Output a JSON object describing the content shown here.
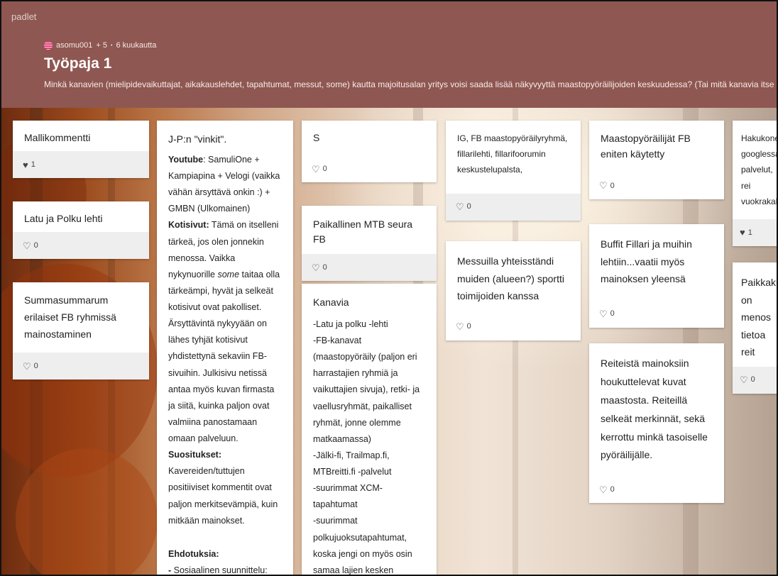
{
  "app": {
    "brand": "padlet"
  },
  "header": {
    "author": "asomu001",
    "extra": "+ 5",
    "sep": "•",
    "time": "6 kuukautta",
    "title": "Työpaja 1",
    "description": "Minkä kanavien (mielipidevaikuttajat, aikakauslehdet, tapahtumat, messut, some) kautta majoitusalan yritys voisi saada lisää näkyvyyttä maastopyöräilijoiden keskuudessa? (Tai mitä kanavia itse käytät tiedonhakemisessa)"
  },
  "cards": {
    "c1": {
      "title": "Mallikommentti",
      "likes": "1"
    },
    "c2": {
      "title": "Latu ja Polku lehti",
      "likes": "0"
    },
    "c3": {
      "title": "Summasummarum erilaiset FB ryhmissä mainostaminen",
      "likes": "0"
    },
    "c4": {
      "title": "J-P:n \"vinkit\".",
      "p1_bold": "Youtube",
      "p1_text": ": SamuliOne + Kampiapina + Velogi (vaikka vähän ärsyttävä onkin :) + GMBN (Ulkomainen)",
      "p2_bold": "Kotisivut:",
      "p2_text_a": " Tämä on itselleni tärkeä, jos olen jonnekin menossa. Vaikka nykynuorille ",
      "p2_em": "some",
      "p2_text_b": " taitaa olla tärkeämpi, hyvät ja selkeät kotisivut ovat pakolliset. Ärsyttävintä nykyyään on lähes tyhjät kotisivut yhdistettynä sekaviin FB-sivuihin. Julkisivu  netissä antaa myös kuvan firmasta ja siitä, kuinka paljon ovat valmiina panostamaan omaan palveluun.",
      "p3_bold": "Suositukset:",
      "p3_text": " Kavereiden/tuttujen positiiviset kommentit ovat paljon merkitsevämpiä, kuin mitkään mainokset.",
      "p4_bold": "Ehdotuksia:",
      "p5_bold": "- ",
      "p5_text": "Sosiaalinen suunnittelu: otetaan"
    },
    "c5": {
      "title": "S",
      "likes": "0"
    },
    "c6": {
      "title": "Paikallinen MTB seura FB",
      "likes": "0"
    },
    "c7": {
      "title": "Kanavia",
      "lines": [
        "-Latu ja polku -lehti",
        "-FB-kanavat (maastopyöräily (paljon eri harrastajien ryhmiä ja vaikuttajien sivuja), retki- ja vaellusryhmät, paikalliset ryhmät, jonne olemme matkaamassa)",
        "-Jälki-fi, Trailmap.fi, MTBreitti.fi -palvelut",
        "-suurimmat XCM-tapahtumat",
        "-suurimmat polkujuoksutapahtumat, koska jengi on myös osin samaa lajien kesken"
      ]
    },
    "c8": {
      "title": "IG, FB maastopyöräilyryhmä, fillarilehti, fillarifoorumin keskustelupalsta,",
      "likes": "0"
    },
    "c9": {
      "title": "Messuilla yhteisständi muiden (alueen?) sportti toimijoiden kanssa",
      "likes": "0"
    },
    "c10": {
      "title": "Maastopyöräilijät FB eniten käytetty",
      "likes": "0"
    },
    "c11": {
      "title": "Buffit Fillari ja muihin lehtiin...vaatii myös mainoksen yleensä",
      "likes": "0"
    },
    "c12": {
      "title": "Reiteistä mainoksiin houkuttelevat kuvat maastosta. Reiteillä selkeät merkinnät, sekä kerrottu minkä tasoiselle pyöräilijälle.",
      "likes": "0"
    },
    "c13": {
      "title": "Hakukoneo googlessa. palvelut, rei vuokrakalus",
      "likes": "1"
    },
    "c14": {
      "title": "Paikkakun on menos tietoa reit",
      "likes": "0"
    }
  },
  "colors": {
    "header_bg": "#8f5751",
    "card_bg": "#ffffff",
    "card_footer_bg": "#eeeeee"
  },
  "icons": {
    "like_empty": "heart-outline-icon",
    "like_filled": "heart-filled-icon"
  }
}
